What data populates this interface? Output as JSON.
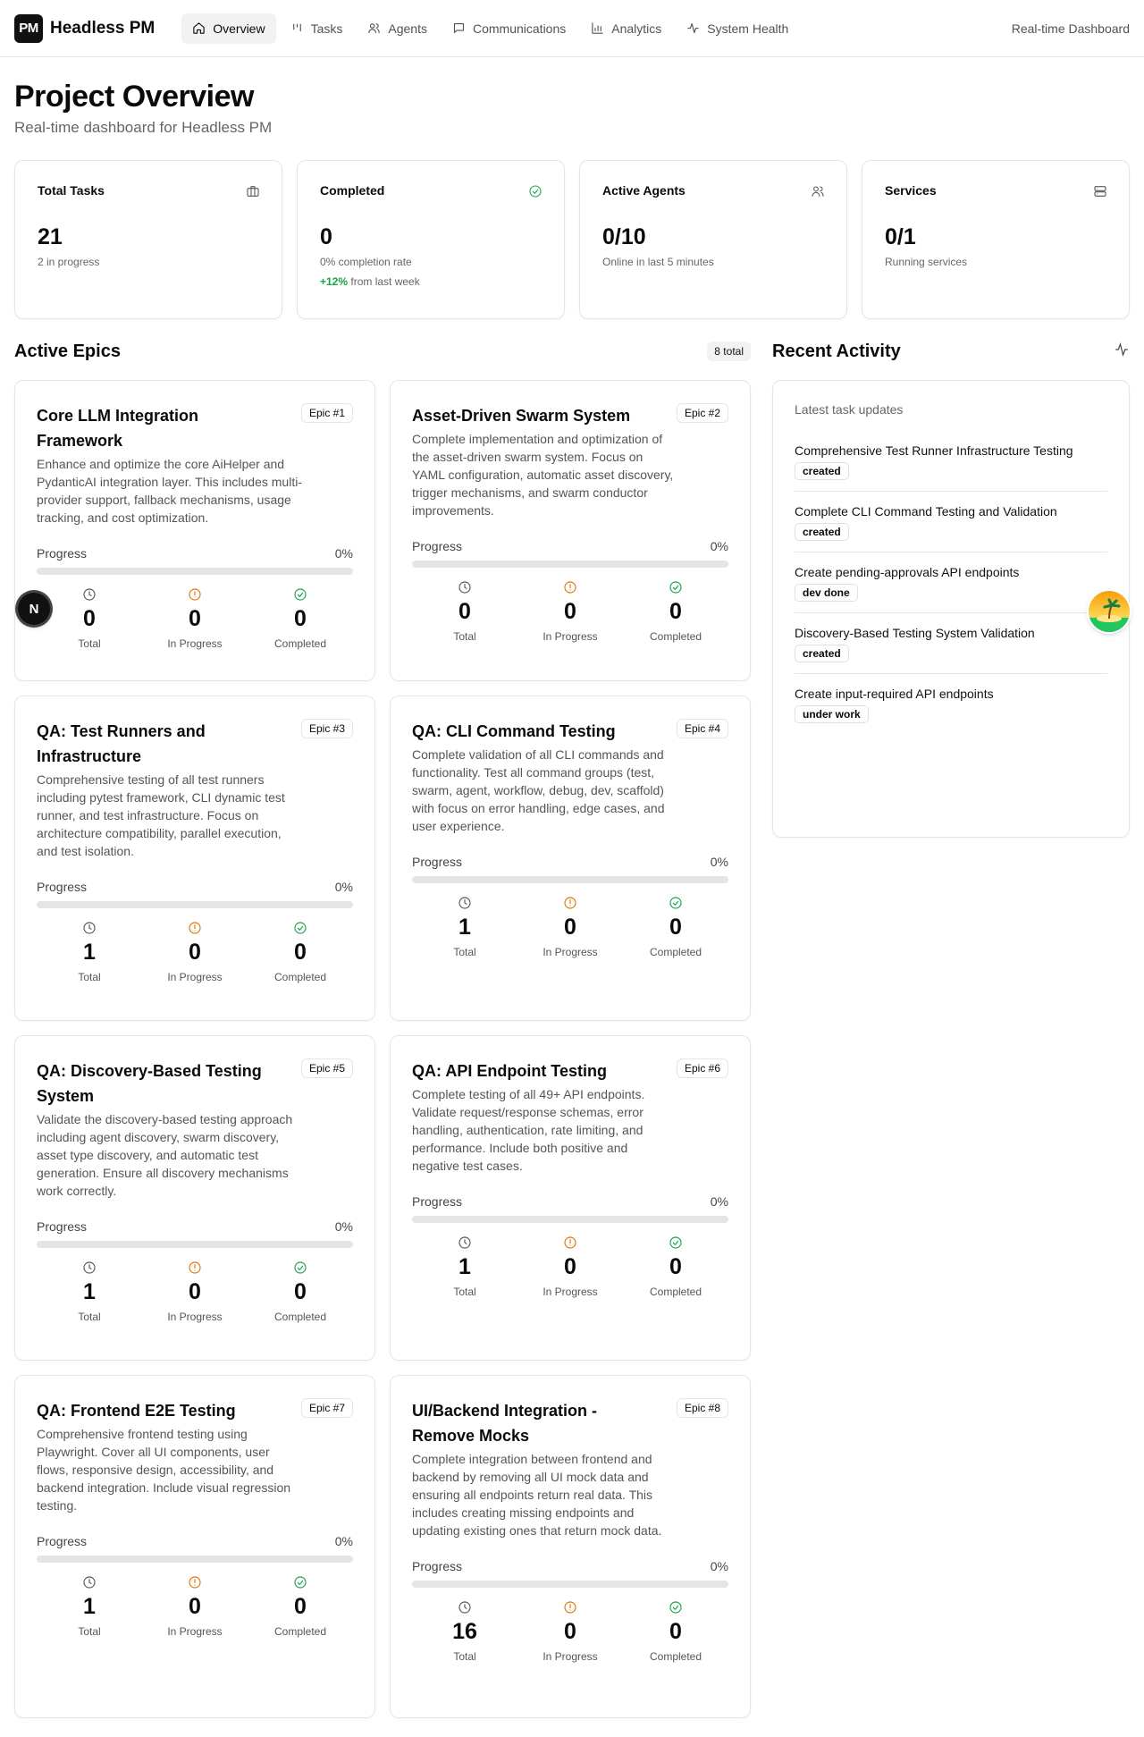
{
  "header": {
    "logo_text": "PM",
    "brand": "Headless PM",
    "nav": [
      {
        "label": "Overview",
        "icon": "home-icon",
        "active": true
      },
      {
        "label": "Tasks",
        "icon": "kanban-icon",
        "active": false
      },
      {
        "label": "Agents",
        "icon": "users-icon",
        "active": false
      },
      {
        "label": "Communications",
        "icon": "message-icon",
        "active": false
      },
      {
        "label": "Analytics",
        "icon": "bar-chart-icon",
        "active": false
      },
      {
        "label": "System Health",
        "icon": "activity-icon",
        "active": false
      }
    ],
    "right_label": "Real-time Dashboard"
  },
  "page": {
    "title": "Project Overview",
    "subtitle": "Real-time dashboard for Headless PM"
  },
  "stats": [
    {
      "label": "Total Tasks",
      "value": "21",
      "note": "2 in progress",
      "icon": "briefcase-icon"
    },
    {
      "label": "Completed",
      "value": "0",
      "note": "0% completion rate",
      "trend_value": "+12%",
      "trend_text": " from last week",
      "icon": "check-circle-icon"
    },
    {
      "label": "Active Agents",
      "value": "0/10",
      "note": "Online in last 5 minutes",
      "icon": "users-icon"
    },
    {
      "label": "Services",
      "value": "0/1",
      "note": "Running services",
      "icon": "server-icon"
    }
  ],
  "epics_section": {
    "title": "Active Epics",
    "total_badge": "8 total",
    "progress_label": "Progress",
    "count_labels": {
      "total": "Total",
      "in_progress": "In Progress",
      "completed": "Completed"
    }
  },
  "epics": [
    {
      "title": "Core LLM Integration Framework",
      "badge": "Epic #1",
      "desc": "Enhance and optimize the core AiHelper and PydanticAI integration layer. This includes multi-provider support, fallback mechanisms, usage tracking, and cost optimization.",
      "progress_text": "0%",
      "progress": 0,
      "total": "0",
      "in_progress": "0",
      "completed": "0"
    },
    {
      "title": "Asset-Driven Swarm System",
      "badge": "Epic #2",
      "desc": "Complete implementation and optimization of the asset-driven swarm system. Focus on YAML configuration, automatic asset discovery, trigger mechanisms, and swarm conductor improvements.",
      "progress_text": "0%",
      "progress": 0,
      "total": "0",
      "in_progress": "0",
      "completed": "0"
    },
    {
      "title": "QA: Test Runners and Infrastructure",
      "badge": "Epic #3",
      "desc": "Comprehensive testing of all test runners including pytest framework, CLI dynamic test runner, and test infrastructure. Focus on architecture compatibility, parallel execution, and test isolation.",
      "progress_text": "0%",
      "progress": 0,
      "total": "1",
      "in_progress": "0",
      "completed": "0"
    },
    {
      "title": "QA: CLI Command Testing",
      "badge": "Epic #4",
      "desc": "Complete validation of all CLI commands and functionality. Test all command groups (test, swarm, agent, workflow, debug, dev, scaffold) with focus on error handling, edge cases, and user experience.",
      "progress_text": "0%",
      "progress": 0,
      "total": "1",
      "in_progress": "0",
      "completed": "0"
    },
    {
      "title": "QA: Discovery-Based Testing System",
      "badge": "Epic #5",
      "desc": "Validate the discovery-based testing approach including agent discovery, swarm discovery, asset type discovery, and automatic test generation. Ensure all discovery mechanisms work correctly.",
      "progress_text": "0%",
      "progress": 0,
      "total": "1",
      "in_progress": "0",
      "completed": "0"
    },
    {
      "title": "QA: API Endpoint Testing",
      "badge": "Epic #6",
      "desc": "Complete testing of all 49+ API endpoints. Validate request/response schemas, error handling, authentication, rate limiting, and performance. Include both positive and negative test cases.",
      "progress_text": "0%",
      "progress": 0,
      "total": "1",
      "in_progress": "0",
      "completed": "0"
    },
    {
      "title": "QA: Frontend E2E Testing",
      "badge": "Epic #7",
      "desc": "Comprehensive frontend testing using Playwright. Cover all UI components, user flows, responsive design, accessibility, and backend integration. Include visual regression testing.",
      "progress_text": "0%",
      "progress": 0,
      "total": "1",
      "in_progress": "0",
      "completed": "0"
    },
    {
      "title": "UI/Backend Integration - Remove Mocks",
      "badge": "Epic #8",
      "desc": "Complete integration between frontend and backend by removing all UI mock data and ensuring all endpoints return real data. This includes creating missing endpoints and updating existing ones that return mock data.",
      "progress_text": "0%",
      "progress": 0,
      "total": "16",
      "in_progress": "0",
      "completed": "0"
    }
  ],
  "activity": {
    "title": "Recent Activity",
    "subtitle": "Latest task updates",
    "items": [
      {
        "title": "Comprehensive Test Runner Infrastructure Testing",
        "status": "created"
      },
      {
        "title": "Complete CLI Command Testing and Validation",
        "status": "created"
      },
      {
        "title": "Create pending-approvals API endpoints",
        "status": "dev done"
      },
      {
        "title": "Discovery-Based Testing System Validation",
        "status": "created"
      },
      {
        "title": "Create input-required API endpoints",
        "status": "under work"
      }
    ]
  },
  "floating": {
    "dev_badge_letter": "N"
  },
  "colors": {
    "accent": "#0a0a0a",
    "success": "#16a34a",
    "warning": "#d97706",
    "muted": "#666666",
    "border": "#e5e5e5"
  }
}
